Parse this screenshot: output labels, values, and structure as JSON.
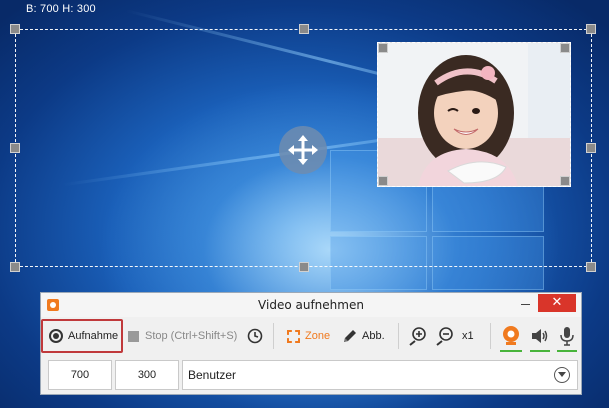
{
  "desktop": {
    "background": "windows-10-hero-wallpaper"
  },
  "selection": {
    "size_label": "B: 700 H: 300"
  },
  "webcam_preview": {
    "content": "webcam-preview-image"
  },
  "recorder": {
    "title": "Video aufnehmen",
    "close_symbol": "✕",
    "toolbar": {
      "record_label": "Aufnahme",
      "stop_label": "Stop (Ctrl+Shift+S)",
      "zone_label": "Zone",
      "screenshot_label": "Abb.",
      "zoom_level": "x1"
    },
    "width_value": "700",
    "height_value": "300",
    "preset_value": "Benutzer"
  },
  "colors": {
    "accent": "#f07a1f",
    "record_highlight": "#c0393b",
    "close": "#d9352a",
    "active_green": "#48b43b"
  }
}
